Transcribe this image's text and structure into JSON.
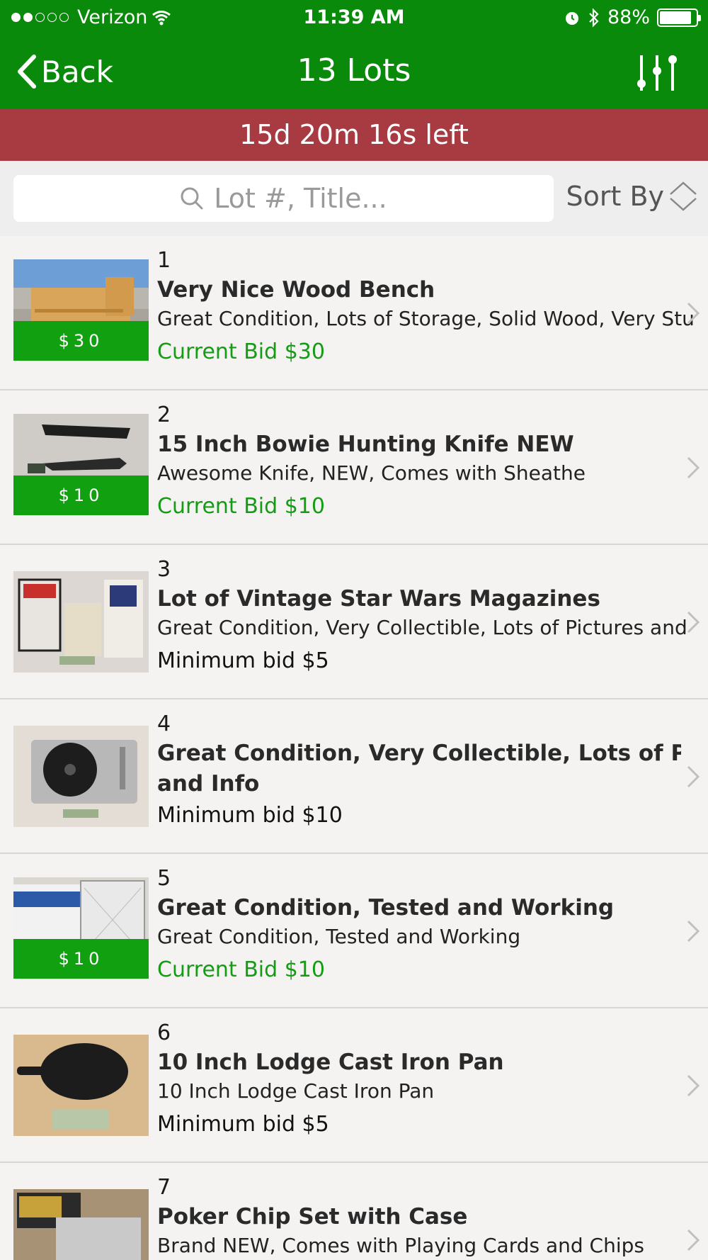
{
  "status_bar": {
    "carrier": "Verizon",
    "time": "11:39 AM",
    "battery": "88%"
  },
  "nav": {
    "back_label": "Back",
    "title": "13 Lots"
  },
  "timer": "15d 20m 16s left",
  "search": {
    "placeholder": "Lot #, Title...",
    "sort_label": "Sort By"
  },
  "lots": [
    {
      "number": "1",
      "title": "Very Nice Wood Bench",
      "description": "Great Condition, Lots of Storage, Solid Wood, Very Sturdy",
      "bid_text": "Current Bid $30",
      "badge": "$30",
      "image": "wooden-bench-photo"
    },
    {
      "number": "2",
      "title": "15 Inch Bowie Hunting Knife NEW",
      "description": "Awesome Knife, NEW, Comes with Sheathe",
      "bid_text": "Current Bid $10",
      "badge": "$10",
      "image": "bowie-knife-photo"
    },
    {
      "number": "3",
      "title": "Lot of Vintage Star Wars Magazines",
      "description": "Great Condition, Very Collectible, Lots of Pictures and Info",
      "bid_text": "Minimum bid $5",
      "badge": "",
      "image": "star-wars-magazines-photo"
    },
    {
      "number": "4",
      "title_line1": "Great Condition, Very Collectible, Lots of Pictures",
      "title_line2": "and Info",
      "bid_text": "Minimum bid $10",
      "badge": "",
      "image": "turntable-photo"
    },
    {
      "number": "5",
      "title": "Great Condition, Tested and Working",
      "description": "Great Condition, Tested and Working",
      "bid_text": "Current Bid $10",
      "badge": "$10",
      "image": "box-fan-photo"
    },
    {
      "number": "6",
      "title": "10 Inch Lodge Cast Iron Pan",
      "description": "10 Inch Lodge Cast Iron Pan",
      "bid_text": "Minimum bid $5",
      "badge": "",
      "image": "cast-iron-pan-photo"
    },
    {
      "number": "7",
      "title": "Poker Chip Set with Case",
      "description": "Brand NEW, Comes with Playing Cards and Chips",
      "bid_text": "",
      "badge": "",
      "image": "poker-chip-set-photo"
    }
  ],
  "colors": {
    "nav_green": "#0a8a0a",
    "timer_red": "#a83a42",
    "bid_green": "#149c14"
  }
}
